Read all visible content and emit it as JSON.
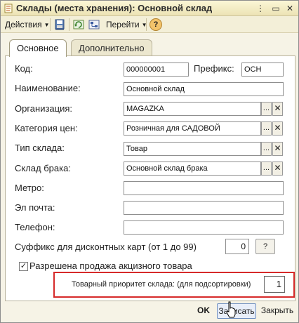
{
  "window": {
    "title": "Склады (места хранения): Основной склад",
    "buttons": {
      "menu": "⋮",
      "restore": "▭",
      "close": "✕"
    }
  },
  "toolbar": {
    "actions_label": "Действия",
    "goto_label": "Перейти",
    "help_label": "?"
  },
  "tabs": [
    {
      "label": "Основное",
      "active": true
    },
    {
      "label": "Дополнительно",
      "active": false
    }
  ],
  "form": {
    "code_label": "Код:",
    "code_value": "000000001",
    "prefix_label": "Префикс:",
    "prefix_value": "ОСН",
    "name_label": "Наименование:",
    "name_value": "Основной склад",
    "org_label": "Организация:",
    "org_value": "MAGAZKA",
    "price_cat_label": "Категория цен:",
    "price_cat_value": "Розничная для САДОВОЙ",
    "type_label": "Тип склада:",
    "type_value": "Товар",
    "defect_label": "Склад брака:",
    "defect_value": "Основной склад брака",
    "metro_label": "Метро:",
    "metro_value": "",
    "email_label": "Эл почта:",
    "email_value": "",
    "phone_label": "Телефон:",
    "phone_value": "",
    "suffix_label": "Суффикс для дисконтных карт (от 1 до 99)",
    "suffix_value": "0",
    "suffix_help": "?",
    "excise_label": "Разрешена продажа акцизного товара",
    "excise_checked": "✓",
    "priority_label": "Товарный приоритет склада: (для подсортировки)",
    "priority_value": "1",
    "select_btn": "...",
    "clear_btn": "✕"
  },
  "bottom": {
    "ok_label": "OK",
    "save_label": "Записать",
    "close_label": "Закрыть"
  },
  "colors": {
    "highlight": "#d62a2a",
    "window_bg": "#f6f3e6",
    "titlebar": "#ece3b5"
  }
}
